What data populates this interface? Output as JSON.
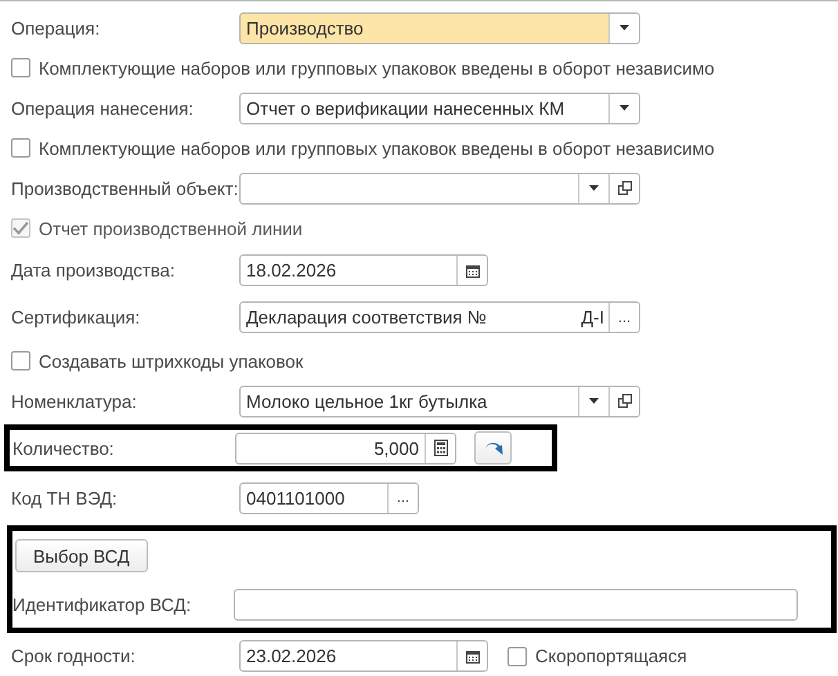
{
  "rows": [
    {
      "kind": "select",
      "label": "Операция:",
      "value": "Производство",
      "highlighted": true,
      "open_button": false
    },
    {
      "kind": "checkbox",
      "label": "Комплектующие наборов или групповых упаковок введены в оборот независимо",
      "checked": false,
      "disabled": false
    },
    {
      "kind": "select",
      "label": "Операция нанесения:",
      "value": "Отчет о верификации нанесенных КМ",
      "highlighted": false,
      "open_button": false
    },
    {
      "kind": "checkbox",
      "label": "Комплектующие наборов или групповых упаковок введены в оборот независимо",
      "checked": false,
      "disabled": false
    },
    {
      "kind": "select",
      "label": "Производственный объект:",
      "highlighted": false,
      "open_button": true
    },
    {
      "kind": "checkbox",
      "label": "Отчет производственной линии",
      "checked": true,
      "disabled": true
    },
    {
      "kind": "date",
      "label": "Дата производства:",
      "value": "18.02.2026"
    },
    {
      "kind": "ref",
      "label": "Сертификация:",
      "value": "Декларация соответствия №",
      "suffix": "Д-I",
      "button": "...",
      "wide": true
    },
    {
      "kind": "checkbox",
      "label": "Создавать штрихкоды упаковок",
      "checked": false,
      "disabled": false
    },
    {
      "kind": "select",
      "label": "Номенклатура:",
      "value": "Молоко цельное 1кг бутылка",
      "highlighted": false,
      "open_button": true
    },
    {
      "kind": "frame",
      "children": [
        {
          "kind": "number",
          "label": "Количество:",
          "value": "5,000"
        }
      ]
    },
    {
      "kind": "ref",
      "label": "Код ТН ВЭД:",
      "value": "0401101000",
      "button": "...",
      "wide": false
    },
    {
      "kind": "frame",
      "children": [
        {
          "kind": "button",
          "label": "Выбор ВСД"
        },
        {
          "kind": "text",
          "label": "Идентификатор ВСД:"
        }
      ]
    },
    {
      "kind": "date",
      "label": "Срок годности:",
      "value": "23.02.2026",
      "extra_checkbox": {
        "label": "Скоропортящаяся",
        "checked": false
      }
    }
  ]
}
